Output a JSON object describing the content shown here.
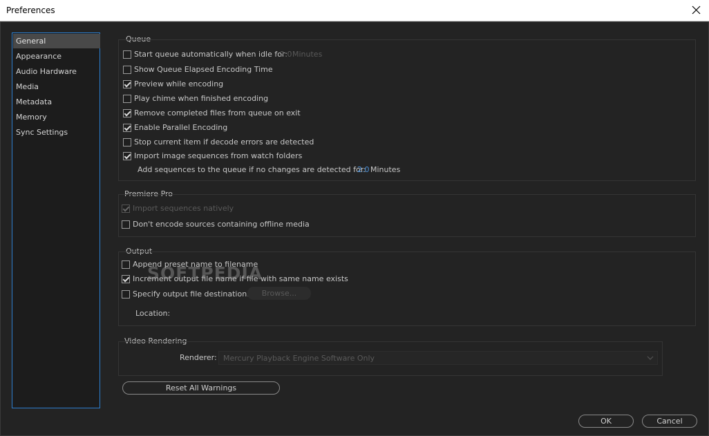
{
  "window": {
    "title": "Preferences"
  },
  "sidebar": {
    "items": [
      {
        "label": "General"
      },
      {
        "label": "Appearance"
      },
      {
        "label": "Audio Hardware"
      },
      {
        "label": "Media"
      },
      {
        "label": "Metadata"
      },
      {
        "label": "Memory"
      },
      {
        "label": "Sync Settings"
      }
    ],
    "selected": "General"
  },
  "queue": {
    "title": "Queue",
    "items": [
      {
        "label": "Start queue automatically when idle for:",
        "checked": false
      },
      {
        "label": "Show Queue Elapsed Encoding Time",
        "checked": false
      },
      {
        "label": "Preview while encoding",
        "checked": true
      },
      {
        "label": "Play chime when finished encoding",
        "checked": false
      },
      {
        "label": "Remove completed files from queue on exit",
        "checked": true
      },
      {
        "label": "Enable Parallel Encoding",
        "checked": true
      },
      {
        "label": "Stop current item if decode errors are detected",
        "checked": false
      },
      {
        "label": "Import image sequences from watch folders",
        "checked": true
      }
    ],
    "idle_value": "2.0",
    "idle_unit": "Minutes",
    "add_sequences_label": "Add sequences to the queue if no changes are detected for:",
    "add_sequences_value": "2.0",
    "add_sequences_unit": "Minutes"
  },
  "premiere": {
    "title": "Premiere Pro",
    "items": [
      {
        "label": "Import sequences natively",
        "checked": true,
        "disabled": true
      },
      {
        "label": "Don't encode sources containing offline media",
        "checked": false
      }
    ]
  },
  "output": {
    "title": "Output",
    "items": [
      {
        "label": "Append preset name to filename",
        "checked": false
      },
      {
        "label": "Increment output file name if file with same name exists",
        "checked": true
      },
      {
        "label": "Specify output file destination:",
        "checked": false
      }
    ],
    "browse_label": "Browse...",
    "location_label": "Location:"
  },
  "video_rendering": {
    "title": "Video Rendering",
    "renderer_label": "Renderer:",
    "renderer_value": "Mercury Playback Engine Software Only"
  },
  "buttons": {
    "reset_warnings": "Reset All Warnings",
    "ok": "OK",
    "cancel": "Cancel"
  },
  "watermark": "SOFTPEDIA",
  "colors": {
    "accent": "#2d7fd1",
    "value_blue": "#4a90d9",
    "background": "#232323"
  }
}
